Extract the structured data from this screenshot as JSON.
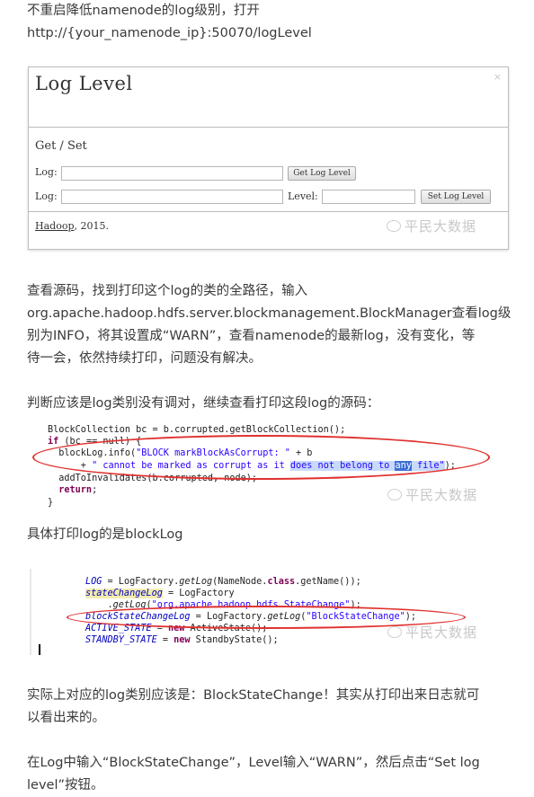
{
  "intro": {
    "line1": "不重启降低namenode的log级别，打开",
    "line2": "http://{your_namenode_ip}:50070/logLevel"
  },
  "loglevel_page": {
    "title": "Log Level",
    "close": "×",
    "section": "Get / Set",
    "row1_label": "Log:",
    "get_button": "Get Log Level",
    "row2_label": "Log:",
    "level_label": "Level:",
    "set_button": "Set Log Level",
    "footer_link": "Hadoop",
    "footer_year": ", 2015."
  },
  "watermark": "平民大数据",
  "para2": {
    "line1": "查看源码，找到打印这个log的类的全路径，输入",
    "line2": "org.apache.hadoop.hdfs.server.blockmanagement.BlockManager查看log级",
    "line3": "别为INFO，将其设置成“WARN”，查看namenode的最新log，没有变化，等",
    "line4": "待一会，依然持续打印，问题没有解决。"
  },
  "para3": "判断应该是log类别没有调对，继续查看打印这段log的源码：",
  "code1": {
    "l1": "BlockCollection bc = b.corrupted.getBlockCollection();",
    "l2a": "if",
    "l2b": " (bc == null) {",
    "l3a": "  blockLog.info(",
    "l3b": "\"BLOCK markBlockAsCorrupt: \"",
    "l3c": " + b",
    "l4a": "      + ",
    "l4b": "\" cannot be marked as corrupt as it ",
    "l4c": "does not belong to ",
    "l4d": "any",
    "l4e": " file\"",
    "l4f": ");",
    "l5": "  addToInvalidates(b.corrupted, node);",
    "l6a": "  return",
    "l6b": ";",
    "l7": "}"
  },
  "para4": "具体打印log的是blockLog",
  "code2": {
    "l1a": "LOG",
    "l1b": " = LogFactory.",
    "l1c": "getLog",
    "l1d": "(NameNode.",
    "l1e": "class",
    "l1f": ".getName());",
    "l2a": "stateChangeLog",
    "l2b": " = LogFactory",
    "l3a": "    .",
    "l3b": "getLog",
    "l3c": "(",
    "l3d": "\"org.apache.hadoop.hdfs.StateChange\"",
    "l3e": ");",
    "l4a": "blockStateChangeLog",
    "l4b": " = LogFactory.",
    "l4c": "getLog",
    "l4d": "(",
    "l4e": "\"BlockStateChange\"",
    "l4f": ");",
    "l5a": "ACTIVE_STATE",
    "l5b": " = ",
    "l5c": "new",
    "l5d": " ActiveState();",
    "l6a": "STANDBY_STATE",
    "l6b": " = ",
    "l6c": "new",
    "l6d": " StandbyState();"
  },
  "para5": {
    "line1": "实际上对应的log类别应该是：BlockStateChange！其实从打印出来日志就可",
    "line2": "以看出来的。"
  },
  "para6": {
    "line1": "在Log中输入“BlockStateChange”，Level输入“WARN”，然后点击“Set log",
    "line2": "level”按钮。"
  }
}
